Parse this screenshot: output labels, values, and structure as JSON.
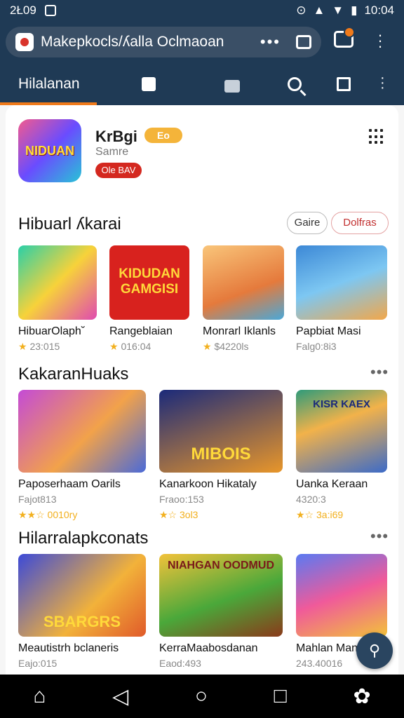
{
  "status": {
    "time_left": "2Ł09",
    "time_right": "10:04"
  },
  "url_bar": {
    "text": "Makepkocls/ʎalla Oclmaoan",
    "more": "•••"
  },
  "top_nav": {
    "tab_label": "Hilalanan"
  },
  "app": {
    "name": "KrBgi",
    "badge": "Eo",
    "subtitle": "Samre",
    "action": "Ole BAV",
    "logo_text": "NIDUAN"
  },
  "sections": [
    {
      "title": "Hibuarl ʎkarai",
      "chips": [
        "Gaire",
        "Dolfras"
      ],
      "items": [
        {
          "label": "HibuarOlaph˘",
          "meta": "23:015",
          "tile_text": ""
        },
        {
          "label": "Rangeblaian",
          "meta": "016:04",
          "tile_text": "KIDUDAN GAMGISI"
        },
        {
          "label": "Monrarl Iklanls",
          "meta": "$4220ls",
          "tile_text": ""
        },
        {
          "label": "Papbiat Masi",
          "meta": "Falg0:8i3",
          "tile_text": ""
        }
      ]
    },
    {
      "title": "KakaranHuaks",
      "items": [
        {
          "label": "Paposerhaam Oarils",
          "meta": "Fajot813",
          "rating": "★★☆ 0010ry",
          "tile_text": ""
        },
        {
          "label": "Kanarkoon Hikataly",
          "meta": "Fraoo:153",
          "rating": "★☆ 3ol3",
          "tile_text": "MIBOIS"
        },
        {
          "label": "Uanka Keraan",
          "meta": "4320:3",
          "rating": "★☆ 3a:i69",
          "tile_text": "KISR KAEX"
        }
      ]
    },
    {
      "title": "Hilarralapkconats",
      "items": [
        {
          "label": "Meautistrh bclaneris",
          "meta": "Eajo:015",
          "tile_text": "SBARGRS"
        },
        {
          "label": "KerraMaabosdanan",
          "meta": "Eaod:493",
          "tile_text": "NIAHGAN OODMUD"
        },
        {
          "label": "Mahlan Man",
          "meta": "243.40016",
          "tile_text": ""
        }
      ]
    }
  ],
  "colors": {
    "header": "#1f3a55",
    "accent": "#f07a1a",
    "red": "#d4281f"
  }
}
